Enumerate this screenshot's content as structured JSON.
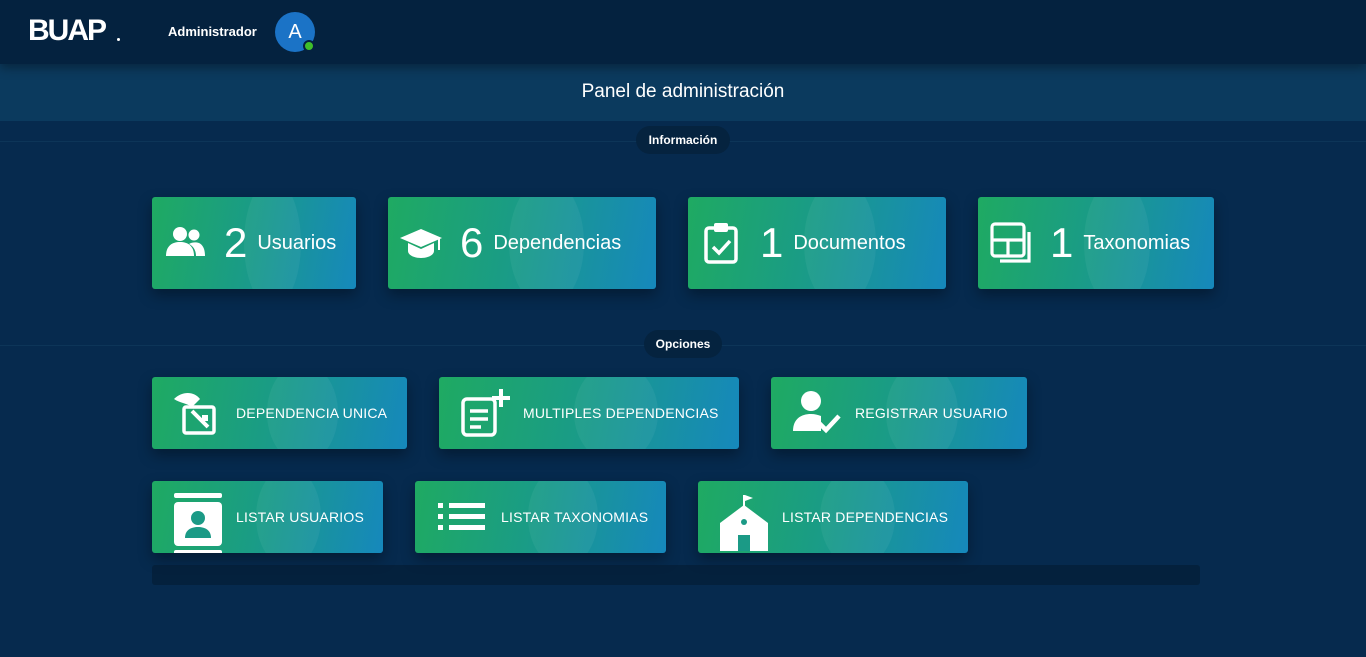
{
  "header": {
    "logo": "BUAP",
    "user_name": "Administrador",
    "avatar_initial": "A"
  },
  "page_title": "Panel de administración",
  "sections": {
    "info": "Información",
    "options": "Opciones"
  },
  "stats": [
    {
      "count": "2",
      "label": "Usuarios",
      "icon": "users-icon"
    },
    {
      "count": "6",
      "label": "Dependencias",
      "icon": "graduation-cap-icon"
    },
    {
      "count": "1",
      "label": "Documentos",
      "icon": "clipboard-check-icon"
    },
    {
      "count": "1",
      "label": "Taxonomias",
      "icon": "layout-icon"
    }
  ],
  "options": [
    {
      "label": "DEPENDENCIA UNICA",
      "icon": "sign-edit-icon"
    },
    {
      "label": "MULTIPLES DEPENDENCIAS",
      "icon": "document-add-icon"
    },
    {
      "label": "REGISTRAR USUARIO",
      "icon": "user-check-icon"
    },
    {
      "label": "LISTAR USUARIOS",
      "icon": "contact-book-icon"
    },
    {
      "label": "LISTAR TAXONOMIAS",
      "icon": "list-icon"
    },
    {
      "label": "LISTAR DEPENDENCIAS",
      "icon": "school-icon"
    }
  ],
  "colors": {
    "background": "#062a4e",
    "topbar": "#04223f",
    "card_start": "#1faa62",
    "card_end": "#1688bc",
    "avatar": "#1b73c6",
    "status_online": "#3fbf2a"
  }
}
